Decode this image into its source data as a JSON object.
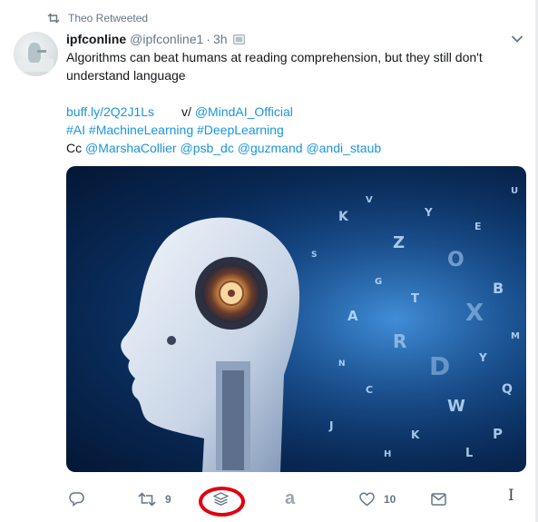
{
  "retweet": {
    "label": "Theo Retweeted",
    "icon": "retweet-icon"
  },
  "tweet": {
    "display_name": "ipfconline",
    "handle": "@ipfconline1",
    "separator": "·",
    "time": "3h",
    "text_line1": "Algorithms can beat humans at reading comprehension, but they still don't",
    "text_line2": "understand language",
    "link": "buff.ly/2Q2J1Ls",
    "via_prefix": "v/",
    "via_handle": "@MindAI_Official",
    "hashtags": [
      "#AI",
      "#MachineLearning",
      "#DeepLearning"
    ],
    "cc_prefix": "Cc",
    "cc_handles": [
      "@MarshaCollier",
      "@psb_dc",
      "@guzmand",
      "@andi_staub"
    ]
  },
  "actions": {
    "reply": {
      "icon": "reply-icon"
    },
    "retweet": {
      "icon": "retweet-icon",
      "count": "9"
    },
    "buffer": {
      "icon": "buffer-layers-icon",
      "highlight_color": "#e3000f"
    },
    "amazon": {
      "icon": "amazon-a-icon",
      "label": "a"
    },
    "like": {
      "icon": "heart-icon",
      "count": "10"
    },
    "dm": {
      "icon": "envelope-icon"
    }
  },
  "cursor": {
    "glyph": "I"
  },
  "colors": {
    "link": "#1b95e0",
    "secondary": "#657786",
    "text": "#14171a"
  }
}
